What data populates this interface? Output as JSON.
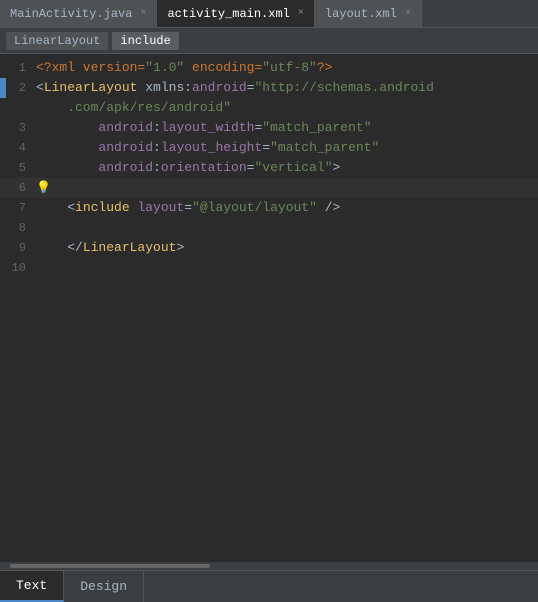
{
  "tabs": [
    {
      "id": "main-activity",
      "label": "MainActivity.java",
      "icon": "☕",
      "active": false,
      "closable": true
    },
    {
      "id": "activity-main",
      "label": "activity_main.xml",
      "icon": "📄",
      "active": true,
      "closable": true
    },
    {
      "id": "layout-xml",
      "label": "layout.xml",
      "icon": "📄",
      "active": false,
      "closable": true
    }
  ],
  "breadcrumbs": [
    {
      "id": "linear-layout",
      "label": "LinearLayout",
      "active": false
    },
    {
      "id": "include",
      "label": "include",
      "active": true
    }
  ],
  "lines": [
    {
      "num": "1",
      "parts": [
        {
          "type": "xml-decl",
          "text": "<?xml version="
        },
        {
          "type": "xml-decl-val",
          "text": "\"1.0\""
        },
        {
          "type": "xml-decl",
          "text": " encoding="
        },
        {
          "type": "xml-decl-val",
          "text": "\"utf-8\""
        },
        {
          "type": "xml-decl",
          "text": "?>"
        }
      ]
    },
    {
      "num": "2",
      "indicator": true,
      "parts": [
        {
          "type": "bracket",
          "text": "<"
        },
        {
          "type": "tag",
          "text": "LinearLayout"
        },
        {
          "type": "plain",
          "text": " xmlns:"
        },
        {
          "type": "ns-prefix",
          "text": "android"
        },
        {
          "type": "plain",
          "text": "="
        },
        {
          "type": "url-val",
          "text": "\"http://schemas.android"
        }
      ]
    },
    {
      "num": "",
      "parts": [
        {
          "type": "url-val",
          "text": "    .com/apk/res/android\""
        }
      ]
    },
    {
      "num": "3",
      "parts": [
        {
          "type": "plain",
          "text": "        "
        },
        {
          "type": "ns-prefix",
          "text": "android"
        },
        {
          "type": "plain",
          "text": ":"
        },
        {
          "type": "attr-name",
          "text": "layout_width"
        },
        {
          "type": "plain",
          "text": "="
        },
        {
          "type": "attr-val",
          "text": "\"match_parent\""
        }
      ]
    },
    {
      "num": "4",
      "parts": [
        {
          "type": "plain",
          "text": "        "
        },
        {
          "type": "ns-prefix",
          "text": "android"
        },
        {
          "type": "plain",
          "text": ":"
        },
        {
          "type": "attr-name",
          "text": "layout_height"
        },
        {
          "type": "plain",
          "text": "="
        },
        {
          "type": "attr-val",
          "text": "\"match_parent\""
        }
      ]
    },
    {
      "num": "5",
      "parts": [
        {
          "type": "plain",
          "text": "        "
        },
        {
          "type": "ns-prefix",
          "text": "android"
        },
        {
          "type": "plain",
          "text": ":"
        },
        {
          "type": "attr-name",
          "text": "orientation"
        },
        {
          "type": "plain",
          "text": "="
        },
        {
          "type": "attr-val",
          "text": "\"vertical\""
        },
        {
          "type": "bracket",
          "text": ">"
        }
      ]
    },
    {
      "num": "6",
      "bulb": true,
      "parts": []
    },
    {
      "num": "7",
      "parts": [
        {
          "type": "plain",
          "text": "    "
        },
        {
          "type": "bracket",
          "text": "<"
        },
        {
          "type": "tag",
          "text": "include"
        },
        {
          "type": "plain",
          "text": " "
        },
        {
          "type": "attr-name",
          "text": "layout"
        },
        {
          "type": "plain",
          "text": "="
        },
        {
          "type": "attr-val",
          "text": "\"@layout/layout\""
        },
        {
          "type": "plain",
          "text": " "
        },
        {
          "type": "bracket",
          "text": "/>"
        }
      ]
    },
    {
      "num": "8",
      "parts": []
    },
    {
      "num": "9",
      "parts": [
        {
          "type": "plain",
          "text": "    "
        },
        {
          "type": "bracket",
          "text": "</"
        },
        {
          "type": "tag",
          "text": "LinearLayout"
        },
        {
          "type": "bracket",
          "text": ">"
        }
      ]
    },
    {
      "num": "10",
      "parts": []
    }
  ],
  "bottomTabs": [
    {
      "id": "text",
      "label": "Text",
      "active": true
    },
    {
      "id": "design",
      "label": "Design",
      "active": false
    }
  ]
}
